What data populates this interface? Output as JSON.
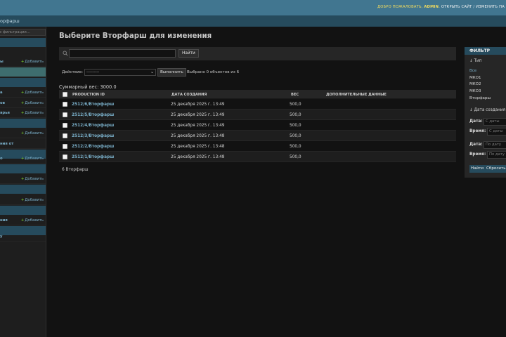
{
  "header": {
    "welcome": "ДОБРО ПОЖАЛОВАТЬ,",
    "username": "ADMIN",
    "view_site": "ОТКРЫТЬ САЙТ",
    "separator": "/",
    "change_password": "ИЗМЕНИТЬ ПА"
  },
  "breadcrumbs": {
    "current": "орфарш"
  },
  "sidebar": {
    "filter_placeholder": "е фильтрации...",
    "add_label": "Добавить",
    "items": [
      {
        "label": "ы",
        "add": true
      },
      {
        "label": "",
        "add": false
      },
      {
        "label": "а",
        "add": true
      },
      {
        "label": "ов",
        "add": true
      },
      {
        "label": "ярья",
        "add": true
      },
      {
        "label": "",
        "add": true
      },
      {
        "label": "ния от",
        "add": false
      },
      {
        "label": "о",
        "add": true
      },
      {
        "label": "",
        "add": true
      },
      {
        "label": "",
        "add": true
      },
      {
        "label": "ния",
        "add": true
      },
      {
        "label": "у",
        "add": false
      }
    ]
  },
  "main": {
    "title": "Выберите Вторфарш для изменения",
    "search_button": "Найти",
    "actions": {
      "label": "Действие:",
      "selected": "---------",
      "go_button": "Выполнить",
      "counter": "Выбрано 0 объектов из 6"
    },
    "summary": "Суммарный вес: 3000.0",
    "table": {
      "headers": [
        "PRODUCTION ID",
        "ДАТА СОЗДАНИЯ",
        "ВЕС",
        "ДОПОЛНИТЕЛЬНЫЕ ДАННЫЕ"
      ],
      "rows": [
        {
          "id": "2512/6/Вторфарш",
          "date": "25 декабря 2025 г. 13:49",
          "weight": "500,0",
          "extra": ""
        },
        {
          "id": "2512/5/Вторфарш",
          "date": "25 декабря 2025 г. 13:49",
          "weight": "500,0",
          "extra": ""
        },
        {
          "id": "2512/4/Вторфарш",
          "date": "25 декабря 2025 г. 13:49",
          "weight": "500,0",
          "extra": ""
        },
        {
          "id": "2512/3/Вторфарш",
          "date": "25 декабря 2025 г. 13:48",
          "weight": "500,0",
          "extra": ""
        },
        {
          "id": "2512/2/Вторфарш",
          "date": "25 декабря 2025 г. 13:48",
          "weight": "500,0",
          "extra": ""
        },
        {
          "id": "2512/1/Вторфарш",
          "date": "25 декабря 2025 г. 13:48",
          "weight": "500,0",
          "extra": ""
        }
      ]
    },
    "paginator": "6 Вторфарш"
  },
  "filter": {
    "title": "ФИЛЬТР",
    "type_heading": "↓ Тип",
    "type_options": [
      "Все",
      "МКО1",
      "МКО2",
      "МКО3",
      "Вторфарш"
    ],
    "date_heading": "↓ Дата создания",
    "date_label": "Дата:",
    "time_label": "Время:",
    "from_date_placeholder": "С даты",
    "from_time_placeholder": "С даты",
    "to_date_placeholder": "По дату",
    "to_time_placeholder": "По дату",
    "search_button": "Найти",
    "reset_button": "Сбросить"
  },
  "colors": {
    "header_bg": "#417690",
    "breadcrumb_bg": "#264b5d",
    "link": "#79aec8",
    "add_plus": "#70bf2b",
    "selected_row": "#3e6d6e",
    "user_tools": "#f5dd5d"
  },
  "icons": {
    "search": "search-icon",
    "add": "plus-icon",
    "dropdown": "chevron-down-icon"
  }
}
